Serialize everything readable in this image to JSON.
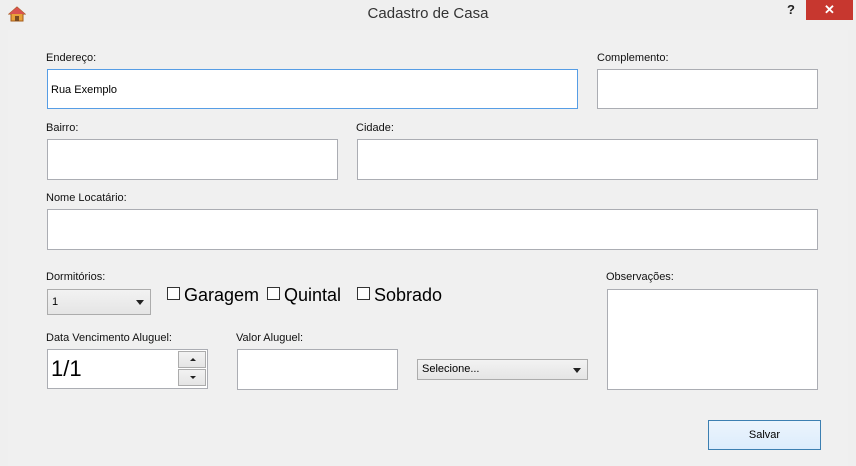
{
  "window": {
    "title": "Cadastro de Casa",
    "help_label": "?",
    "close_label": "✕"
  },
  "form": {
    "endereco_label": "Endereço:",
    "endereco_value": "Rua Exemplo",
    "complemento_label": "Complemento:",
    "complemento_value": "",
    "bairro_label": "Bairro:",
    "bairro_value": "",
    "cidade_label": "Cidade:",
    "cidade_value": "",
    "nome_locatario_label": "Nome Locatário:",
    "nome_locatario_value": "",
    "dormitorios_label": "Dormitórios:",
    "dormitorios_value": "1",
    "garagem_label": "Garagem",
    "quintal_label": "Quintal",
    "sobrado_label": "Sobrado",
    "observacoes_label": "Observações:",
    "observacoes_value": "",
    "data_vencimento_label": "Data Vencimento Aluguel:",
    "data_vencimento_value": "1/1",
    "valor_aluguel_label": "Valor Aluguel:",
    "valor_aluguel_value": "",
    "selecione_value": "Selecione...",
    "salvar_label": "Salvar"
  },
  "colors": {
    "focus_border": "#569de5",
    "close_button": "#c7372f"
  }
}
